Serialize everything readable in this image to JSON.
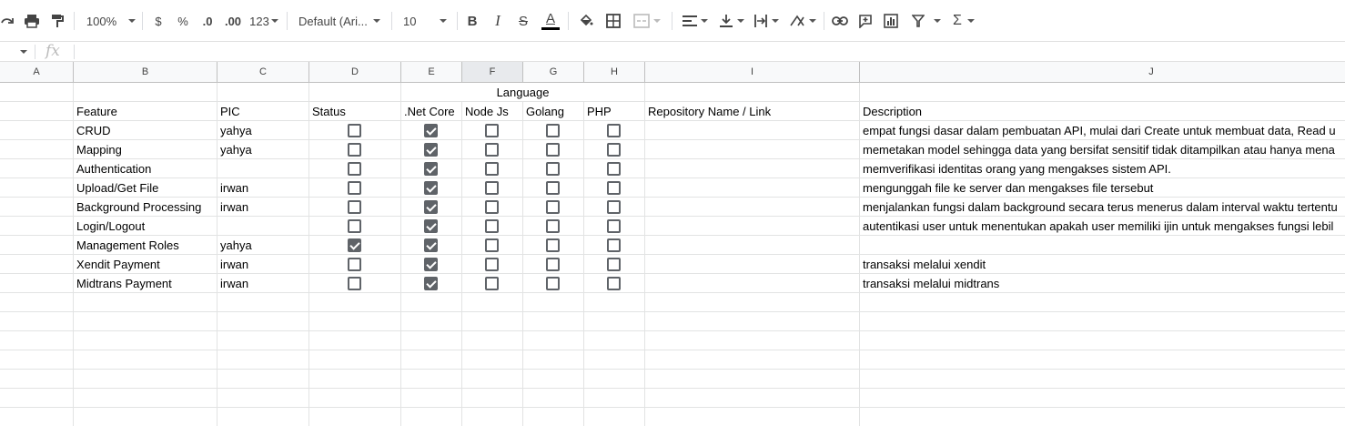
{
  "toolbar": {
    "zoom": "100%",
    "currency": "$",
    "percent": "%",
    "dec_less": ".0",
    "dec_more": ".00",
    "format_more": "123",
    "font": "Default (Ari...",
    "font_size": "10",
    "bold": "B",
    "italic": "I",
    "strike": "S",
    "text_color": "A",
    "sum": "Σ"
  },
  "formula_bar": {
    "fx": "fx",
    "value": ""
  },
  "columns": [
    "A",
    "B",
    "C",
    "D",
    "E",
    "F",
    "G",
    "H",
    "I",
    "J"
  ],
  "group_header": "Language",
  "headers": {
    "feature": "Feature",
    "pic": "PIC",
    "status": "Status",
    "netcore": ".Net Core",
    "nodejs": "Node Js",
    "golang": "Golang",
    "php": "PHP",
    "repo": "Repository Name / Link",
    "description": "Description"
  },
  "rows": [
    {
      "feature": "CRUD",
      "pic": "yahya",
      "status": false,
      "netcore": true,
      "nodejs": false,
      "golang": false,
      "php": false,
      "description": "empat fungsi dasar dalam pembuatan API, mulai dari Create untuk membuat data, Read u"
    },
    {
      "feature": "Mapping",
      "pic": "yahya",
      "status": false,
      "netcore": true,
      "nodejs": false,
      "golang": false,
      "php": false,
      "description": "memetakan model sehingga data yang bersifat sensitif tidak ditampilkan atau hanya mena"
    },
    {
      "feature": "Authentication",
      "pic": "",
      "status": false,
      "netcore": true,
      "nodejs": false,
      "golang": false,
      "php": false,
      "description": "memverifikasi identitas orang yang mengakses sistem API."
    },
    {
      "feature": "Upload/Get File",
      "pic": "irwan",
      "status": false,
      "netcore": true,
      "nodejs": false,
      "golang": false,
      "php": false,
      "description": "mengunggah file ke server dan mengakses file tersebut"
    },
    {
      "feature": "Background Processing",
      "pic": "irwan",
      "status": false,
      "netcore": true,
      "nodejs": false,
      "golang": false,
      "php": false,
      "description": "menjalankan fungsi dalam background secara terus menerus dalam interval waktu tertentu"
    },
    {
      "feature": "Login/Logout",
      "pic": "",
      "status": false,
      "netcore": true,
      "nodejs": false,
      "golang": false,
      "php": false,
      "description": "autentikasi user untuk menentukan apakah user memiliki ijin untuk mengakses fungsi lebil"
    },
    {
      "feature": "Management Roles",
      "pic": "yahya",
      "status": true,
      "netcore": true,
      "nodejs": false,
      "golang": false,
      "php": false,
      "description": ""
    },
    {
      "feature": "Xendit Payment",
      "pic": "irwan",
      "status": false,
      "netcore": true,
      "nodejs": false,
      "golang": false,
      "php": false,
      "description": "transaksi melalui xendit"
    },
    {
      "feature": "Midtrans Payment",
      "pic": "irwan",
      "status": false,
      "netcore": true,
      "nodejs": false,
      "golang": false,
      "php": false,
      "description": "transaksi melalui midtrans"
    }
  ],
  "colors": {
    "checkbox": "#5f6368",
    "grid": "#e2e3e3",
    "header_bg": "#f8f9fa",
    "selected_header": "#e8eaed"
  }
}
